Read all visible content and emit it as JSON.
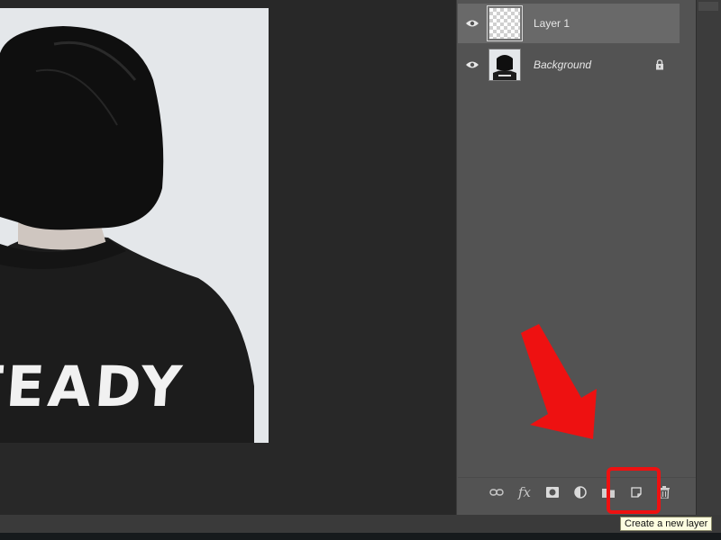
{
  "canvas": {
    "photo_text": "TEADY"
  },
  "layers_panel": {
    "layers": [
      {
        "name": "Layer 1",
        "visible": true,
        "selected": true,
        "locked": false,
        "thumbnail": "transparent-checker"
      },
      {
        "name": "Background",
        "visible": true,
        "selected": false,
        "locked": true,
        "thumbnail": "photo"
      }
    ],
    "bottom_tools": [
      {
        "name": "link-layers",
        "icon": "link-icon"
      },
      {
        "name": "layer-style",
        "label": "fx"
      },
      {
        "name": "layer-mask",
        "icon": "mask-icon"
      },
      {
        "name": "adjustment-layer",
        "icon": "half-circle-icon"
      },
      {
        "name": "group",
        "icon": "folder-icon"
      },
      {
        "name": "new-layer",
        "icon": "new-layer-icon"
      },
      {
        "name": "delete-layer",
        "icon": "trash-icon"
      }
    ]
  },
  "tooltip": {
    "text": "Create a new layer"
  },
  "annotation": {
    "color": "#ee1111"
  }
}
